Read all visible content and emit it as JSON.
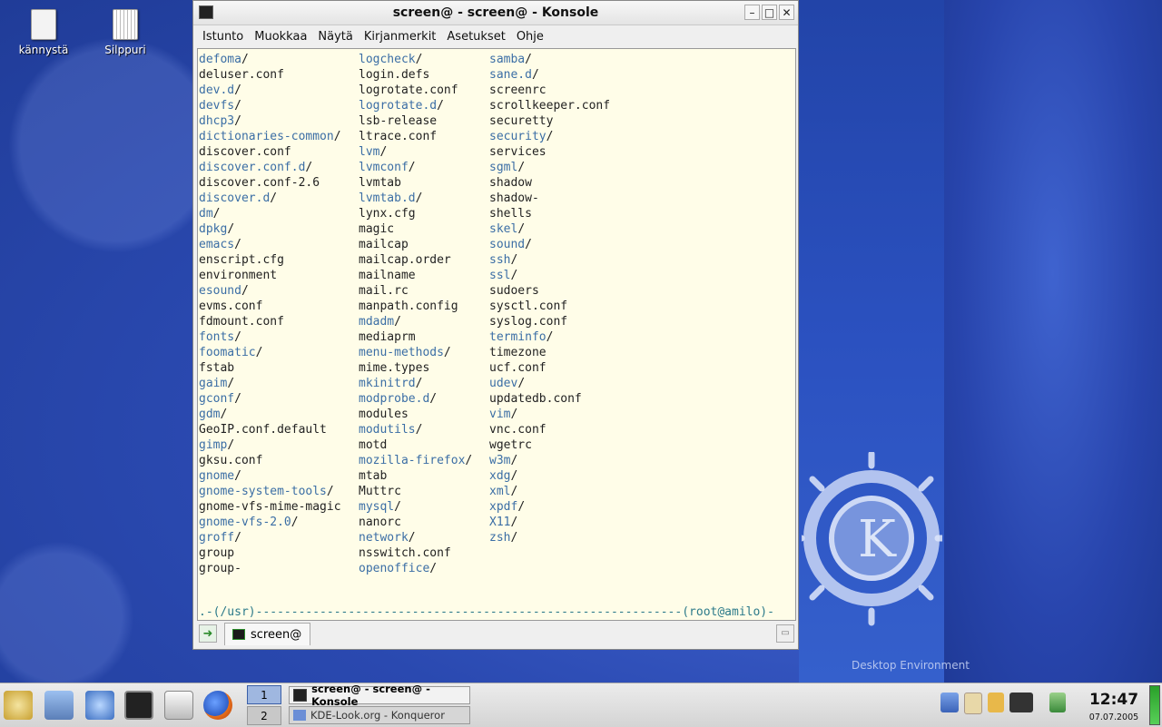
{
  "desktop": {
    "icons": [
      {
        "label": "kännystä"
      },
      {
        "label": "Silppuri"
      }
    ],
    "wallpaper_text": "Desktop Environment"
  },
  "window": {
    "title": "screen@ - screen@ - Konsole",
    "menu": [
      "Istunto",
      "Muokkaa",
      "Näytä",
      "Kirjanmerkit",
      "Asetukset",
      "Ohje"
    ],
    "buttons": {
      "minimize": "–",
      "maximize": "□",
      "close": "✕"
    },
    "tab_label": "screen@"
  },
  "terminal": {
    "columns": [
      [
        {
          "name": "defoma",
          "dir": true
        },
        {
          "name": "deluser.conf",
          "dir": false
        },
        {
          "name": "dev.d",
          "dir": true
        },
        {
          "name": "devfs",
          "dir": true
        },
        {
          "name": "dhcp3",
          "dir": true
        },
        {
          "name": "dictionaries-common",
          "dir": true
        },
        {
          "name": "discover.conf",
          "dir": false
        },
        {
          "name": "discover.conf.d",
          "dir": true
        },
        {
          "name": "discover.conf-2.6",
          "dir": false
        },
        {
          "name": "discover.d",
          "dir": true
        },
        {
          "name": "dm",
          "dir": true
        },
        {
          "name": "dpkg",
          "dir": true
        },
        {
          "name": "emacs",
          "dir": true
        },
        {
          "name": "enscript.cfg",
          "dir": false
        },
        {
          "name": "environment",
          "dir": false
        },
        {
          "name": "esound",
          "dir": true
        },
        {
          "name": "evms.conf",
          "dir": false
        },
        {
          "name": "fdmount.conf",
          "dir": false
        },
        {
          "name": "fonts",
          "dir": true
        },
        {
          "name": "foomatic",
          "dir": true
        },
        {
          "name": "fstab",
          "dir": false
        },
        {
          "name": "gaim",
          "dir": true
        },
        {
          "name": "gconf",
          "dir": true
        },
        {
          "name": "gdm",
          "dir": true
        },
        {
          "name": "GeoIP.conf.default",
          "dir": false
        },
        {
          "name": "gimp",
          "dir": true
        },
        {
          "name": "gksu.conf",
          "dir": false
        },
        {
          "name": "gnome",
          "dir": true
        },
        {
          "name": "gnome-system-tools",
          "dir": true
        },
        {
          "name": "gnome-vfs-mime-magic",
          "dir": false
        },
        {
          "name": "gnome-vfs-2.0",
          "dir": true
        },
        {
          "name": "groff",
          "dir": true
        },
        {
          "name": "group",
          "dir": false
        },
        {
          "name": "group-",
          "dir": false
        }
      ],
      [
        {
          "name": "logcheck",
          "dir": true
        },
        {
          "name": "login.defs",
          "dir": false
        },
        {
          "name": "logrotate.conf",
          "dir": false
        },
        {
          "name": "logrotate.d",
          "dir": true
        },
        {
          "name": "lsb-release",
          "dir": false
        },
        {
          "name": "ltrace.conf",
          "dir": false
        },
        {
          "name": "lvm",
          "dir": true
        },
        {
          "name": "lvmconf",
          "dir": true
        },
        {
          "name": "lvmtab",
          "dir": false
        },
        {
          "name": "lvmtab.d",
          "dir": true
        },
        {
          "name": "lynx.cfg",
          "dir": false
        },
        {
          "name": "magic",
          "dir": false
        },
        {
          "name": "mailcap",
          "dir": false
        },
        {
          "name": "mailcap.order",
          "dir": false
        },
        {
          "name": "mailname",
          "dir": false
        },
        {
          "name": "mail.rc",
          "dir": false
        },
        {
          "name": "manpath.config",
          "dir": false
        },
        {
          "name": "mdadm",
          "dir": true
        },
        {
          "name": "mediaprm",
          "dir": false
        },
        {
          "name": "menu-methods",
          "dir": true
        },
        {
          "name": "mime.types",
          "dir": false
        },
        {
          "name": "mkinitrd",
          "dir": true
        },
        {
          "name": "modprobe.d",
          "dir": true
        },
        {
          "name": "modules",
          "dir": false
        },
        {
          "name": "modutils",
          "dir": true
        },
        {
          "name": "motd",
          "dir": false
        },
        {
          "name": "mozilla-firefox",
          "dir": true
        },
        {
          "name": "mtab",
          "dir": false
        },
        {
          "name": "Muttrc",
          "dir": false
        },
        {
          "name": "mysql",
          "dir": true
        },
        {
          "name": "nanorc",
          "dir": false
        },
        {
          "name": "network",
          "dir": true
        },
        {
          "name": "nsswitch.conf",
          "dir": false
        },
        {
          "name": "openoffice",
          "dir": true
        }
      ],
      [
        {
          "name": "samba",
          "dir": true
        },
        {
          "name": "sane.d",
          "dir": true
        },
        {
          "name": "screenrc",
          "dir": false
        },
        {
          "name": "scrollkeeper.conf",
          "dir": false
        },
        {
          "name": "securetty",
          "dir": false
        },
        {
          "name": "security",
          "dir": true
        },
        {
          "name": "services",
          "dir": false
        },
        {
          "name": "sgml",
          "dir": true
        },
        {
          "name": "shadow",
          "dir": false
        },
        {
          "name": "shadow-",
          "dir": false
        },
        {
          "name": "shells",
          "dir": false
        },
        {
          "name": "skel",
          "dir": true
        },
        {
          "name": "sound",
          "dir": true
        },
        {
          "name": "ssh",
          "dir": true
        },
        {
          "name": "ssl",
          "dir": true
        },
        {
          "name": "sudoers",
          "dir": false
        },
        {
          "name": "sysctl.conf",
          "dir": false
        },
        {
          "name": "syslog.conf",
          "dir": false
        },
        {
          "name": "terminfo",
          "dir": true
        },
        {
          "name": "timezone",
          "dir": false
        },
        {
          "name": "ucf.conf",
          "dir": false
        },
        {
          "name": "udev",
          "dir": true
        },
        {
          "name": "updatedb.conf",
          "dir": false
        },
        {
          "name": "vim",
          "dir": true
        },
        {
          "name": "vnc.conf",
          "dir": false
        },
        {
          "name": "wgetrc",
          "dir": false
        },
        {
          "name": "w3m",
          "dir": true
        },
        {
          "name": "xdg",
          "dir": true
        },
        {
          "name": "xml",
          "dir": true
        },
        {
          "name": "xpdf",
          "dir": true
        },
        {
          "name": "X11",
          "dir": true
        },
        {
          "name": "zsh",
          "dir": true
        }
      ]
    ],
    "prompt_line1": ".-(/usr)------------------------------------------------------------(root@amilo)-",
    "prompt_line2": "`--# "
  },
  "taskbar": {
    "pager": [
      "1",
      "2"
    ],
    "tasks": [
      "screen@ - screen@ - Konsole",
      "KDE-Look.org - Konqueror"
    ],
    "clock_time": "12:47",
    "clock_date": "07.07.2005"
  }
}
